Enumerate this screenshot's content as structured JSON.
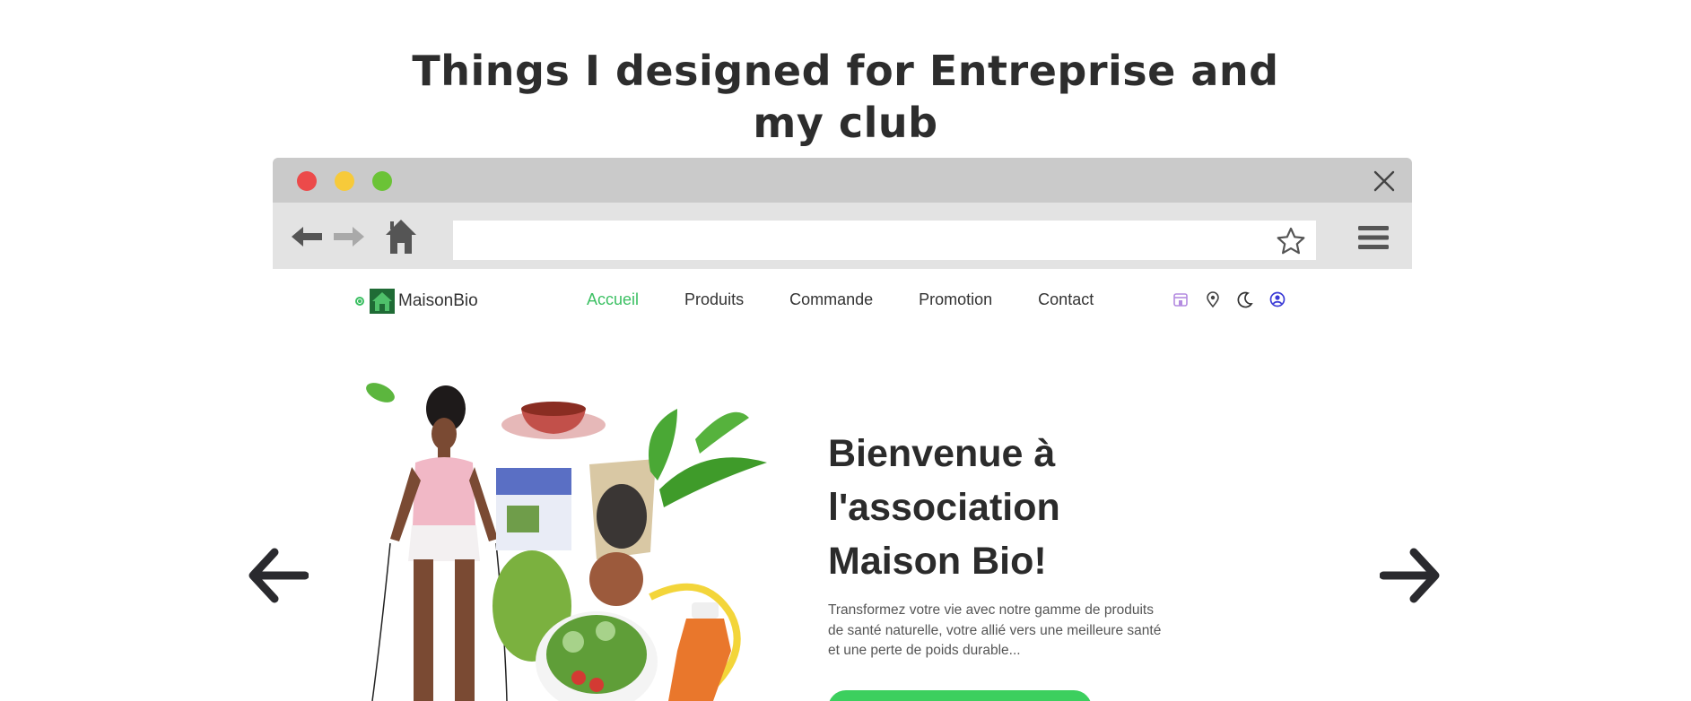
{
  "heading": {
    "line1": "Things I designed for Entreprise and",
    "line2": "my club"
  },
  "browser": {
    "window_controls": [
      "close-dot",
      "minimize-dot",
      "maximize-dot"
    ],
    "address_bar": {
      "value": ""
    }
  },
  "site": {
    "logo_text": "MaisonBio",
    "nav": [
      {
        "label": "Accueil",
        "active": true
      },
      {
        "label": "Produits",
        "active": false
      },
      {
        "label": "Commande",
        "active": false
      },
      {
        "label": "Promotion",
        "active": false
      },
      {
        "label": "Contact",
        "active": false
      }
    ],
    "nav_icons": [
      "store-icon",
      "location-pin-icon",
      "moon-icon",
      "user-icon"
    ],
    "hero": {
      "title_line1": "Bienvenue à",
      "title_line2": "l'association",
      "title_line3": "Maison Bio!",
      "description": "Transformez votre vie avec notre gamme de produits de santé naturelle, votre allié vers une meilleure santé et une perte de poids durable..."
    }
  },
  "colors": {
    "accent_green": "#3cc063",
    "cta_green": "#3ccf5e",
    "titlebar": "#cacaca",
    "toolbar": "#e3e3e3",
    "dot_red": "#ec4a4a",
    "dot_yellow": "#f7ca3a",
    "dot_green": "#6bc336"
  }
}
